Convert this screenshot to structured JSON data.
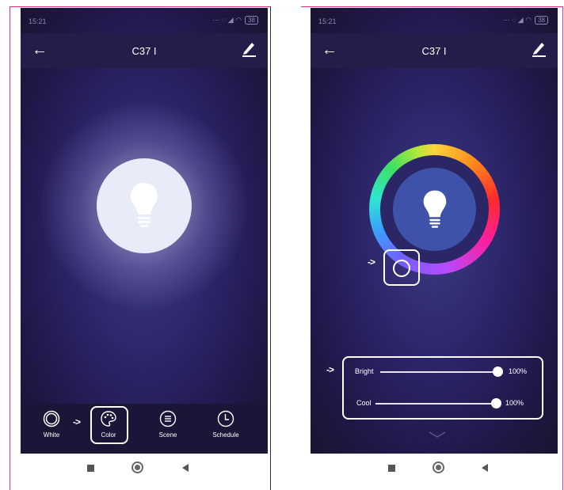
{
  "left_phone": {
    "status": {
      "time": "15:21",
      "battery": "38"
    },
    "appbar": {
      "title": "C37 I"
    },
    "tabs": [
      {
        "label": "White",
        "icon": "white-ring-icon"
      },
      {
        "label": "Color",
        "icon": "palette-icon"
      },
      {
        "label": "Scene",
        "icon": "scene-list-icon"
      },
      {
        "label": "Schedule",
        "icon": "clock-icon"
      }
    ],
    "annotation": "->"
  },
  "right_phone": {
    "status": {
      "time": "15:21",
      "battery": "38"
    },
    "appbar": {
      "title": "C37 I"
    },
    "picker_annotation": "->",
    "sliders_annotation": "->",
    "sliders": [
      {
        "label": "Bright",
        "value": "100%",
        "level": 1.0
      },
      {
        "label": "Cool",
        "value": "100%",
        "level": 1.0
      }
    ]
  },
  "colors": {
    "accent_ring": "conic",
    "screen_bg": "#2a2466",
    "annotation_frame_left": "#e0308c",
    "annotation_frame_right": "#1f2a6a"
  }
}
